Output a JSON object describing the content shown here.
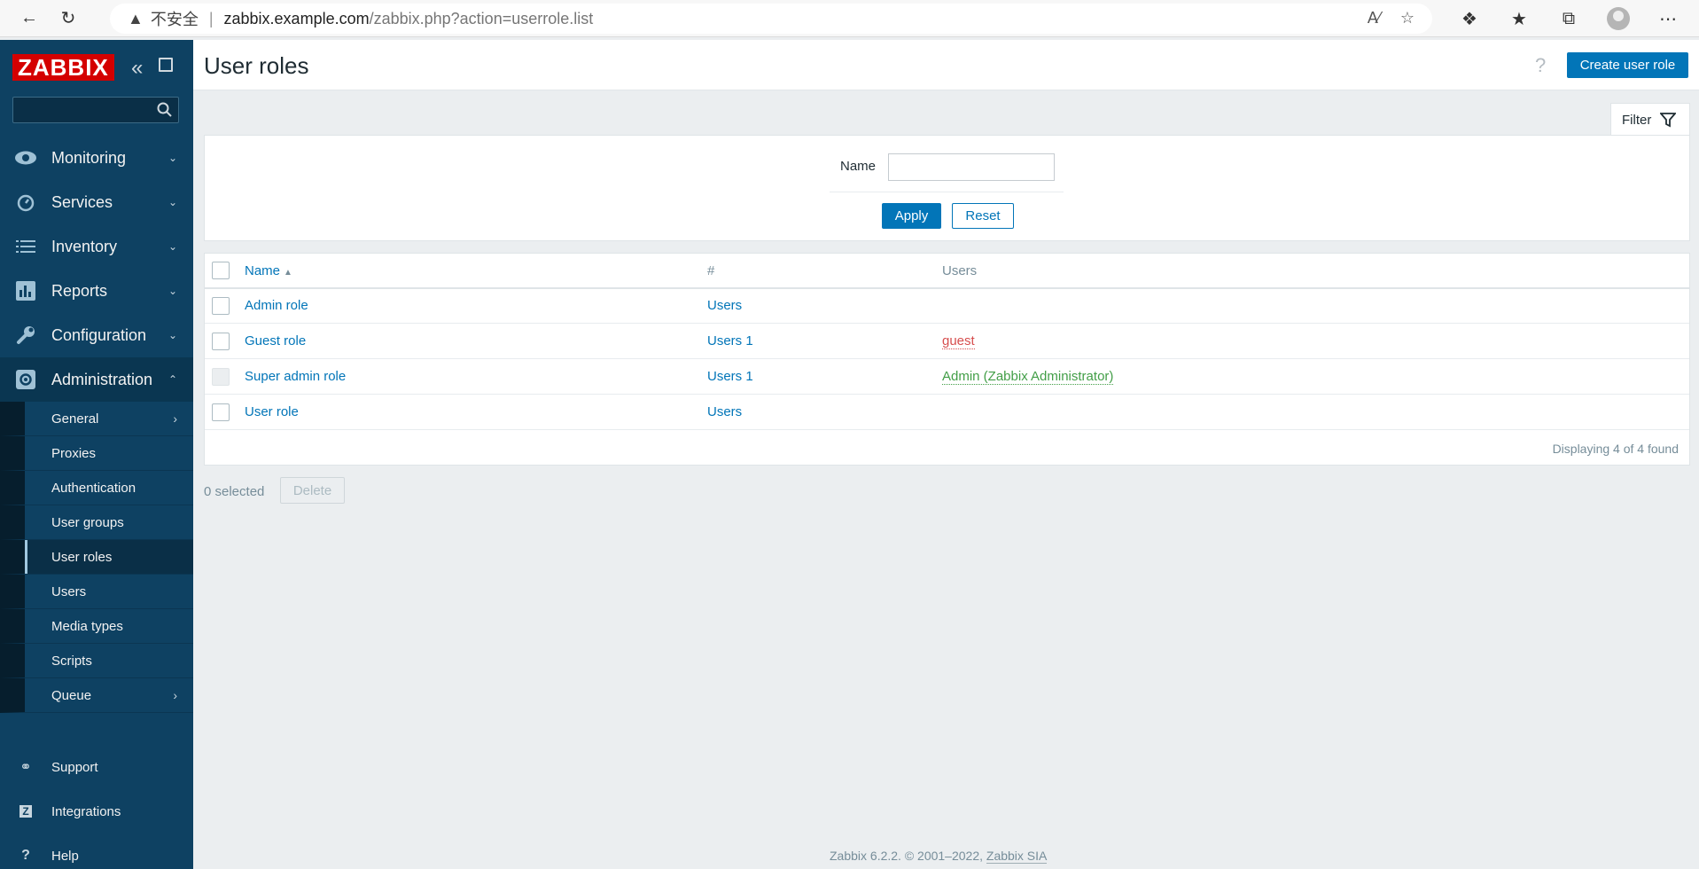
{
  "browser": {
    "warning_text": "不安全",
    "url_host": "zabbix.example.com",
    "url_path": "/zabbix.php?action=userrole.list"
  },
  "sidebar": {
    "logo": "ZABBIX",
    "search_placeholder": "",
    "menu": [
      {
        "label": "Monitoring",
        "icon": "eye-icon"
      },
      {
        "label": "Services",
        "icon": "clock-icon"
      },
      {
        "label": "Inventory",
        "icon": "list-icon"
      },
      {
        "label": "Reports",
        "icon": "bar-chart-icon"
      },
      {
        "label": "Configuration",
        "icon": "wrench-icon"
      },
      {
        "label": "Administration",
        "icon": "gear-icon"
      }
    ],
    "admin_items": [
      "General",
      "Proxies",
      "Authentication",
      "User groups",
      "User roles",
      "Users",
      "Media types",
      "Scripts",
      "Queue"
    ],
    "bottom": [
      {
        "label": "Support",
        "icon": "headset-icon"
      },
      {
        "label": "Integrations",
        "icon": "z-icon"
      },
      {
        "label": "Help",
        "icon": "question-icon"
      }
    ]
  },
  "header": {
    "title": "User roles",
    "help": "?",
    "create_button": "Create user role"
  },
  "filter": {
    "tab_label": "Filter",
    "name_label": "Name",
    "name_value": "",
    "apply": "Apply",
    "reset": "Reset"
  },
  "table": {
    "headers": {
      "name": "Name",
      "count": "#",
      "users": "Users"
    },
    "rows": [
      {
        "name": "Admin role",
        "users_link": "Users",
        "users_count": "",
        "users": "",
        "users_color": ""
      },
      {
        "name": "Guest role",
        "users_link": "Users",
        "users_count": "1",
        "users": "guest",
        "users_color": "#d64e4e"
      },
      {
        "name": "Super admin role",
        "users_link": "Users",
        "users_count": "1",
        "users": "Admin (Zabbix Administrator)",
        "users_color": "#429e47"
      },
      {
        "name": "User role",
        "users_link": "Users",
        "users_count": "",
        "users": "",
        "users_color": ""
      }
    ],
    "display_count": "Displaying 4 of 4 found"
  },
  "actions": {
    "selected": "0 selected",
    "delete": "Delete"
  },
  "footer": {
    "text": "Zabbix 6.2.2. © 2001–2022,",
    "link": "Zabbix SIA"
  },
  "colors": {
    "sidebar": "#0e4162",
    "accent": "#0275b8",
    "background": "#ebeef0"
  }
}
